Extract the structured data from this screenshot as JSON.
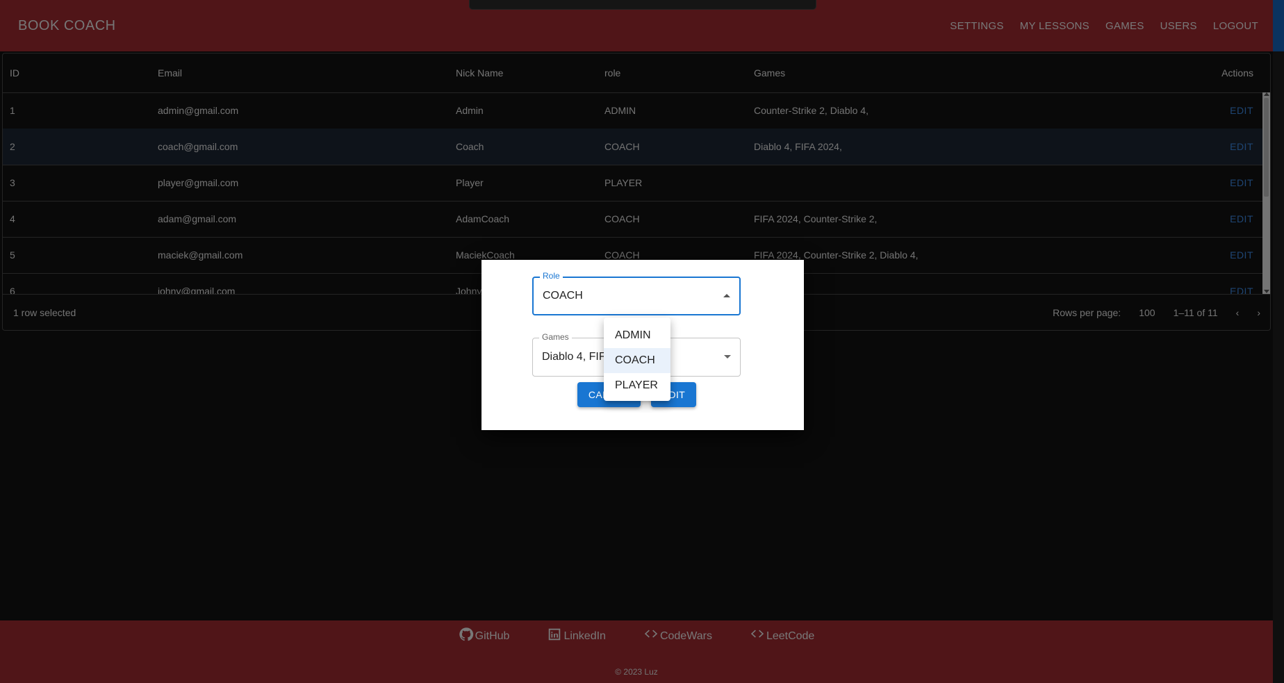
{
  "app": {
    "brand": "BOOK COACH",
    "nav": [
      "SETTINGS",
      "MY LESSONS",
      "GAMES",
      "USERS",
      "LOGOUT"
    ]
  },
  "table": {
    "columns": [
      "ID",
      "Email",
      "Nick Name",
      "role",
      "Games",
      "Actions"
    ],
    "rows": [
      {
        "id": "1",
        "email": "admin@gmail.com",
        "nick": "Admin",
        "role": "ADMIN",
        "games": "Counter-Strike 2, Diablo 4,",
        "action": "EDIT"
      },
      {
        "id": "2",
        "email": "coach@gmail.com",
        "nick": "Coach",
        "role": "COACH",
        "games": "Diablo 4, FIFA 2024,",
        "action": "EDIT"
      },
      {
        "id": "3",
        "email": "player@gmail.com",
        "nick": "Player",
        "role": "PLAYER",
        "games": "",
        "action": "EDIT"
      },
      {
        "id": "4",
        "email": "adam@gmail.com",
        "nick": "AdamCoach",
        "role": "COACH",
        "games": "FIFA 2024, Counter-Strike 2,",
        "action": "EDIT"
      },
      {
        "id": "5",
        "email": "maciek@gmail.com",
        "nick": "MaciekCoach",
        "role": "COACH",
        "games": "FIFA 2024, Counter-Strike 2, Diablo 4,",
        "action": "EDIT"
      },
      {
        "id": "6",
        "email": "johny@gmail.com",
        "nick": "Johny",
        "role": "",
        "games": "",
        "action": "EDIT"
      }
    ],
    "selected_text": "1 row selected",
    "rows_per_page_label": "Rows per page:",
    "rows_per_page": "100",
    "range": "1–11 of 11"
  },
  "dialog": {
    "role_label": "Role",
    "role_value": "COACH",
    "games_label": "Games",
    "games_value": "Diablo 4, FIFA 2024",
    "cancel": "CANCEL",
    "edit": "EDIT"
  },
  "role_menu": {
    "options": [
      "ADMIN",
      "COACH",
      "PLAYER"
    ],
    "selected": "COACH"
  },
  "footer": {
    "links": [
      {
        "label": "GitHub",
        "icon": "github-icon"
      },
      {
        "label": "LinkedIn",
        "icon": "linkedin-icon"
      },
      {
        "label": "CodeWars",
        "icon": "code-icon"
      },
      {
        "label": "LeetCode",
        "icon": "code-icon"
      }
    ],
    "copyright": "© 2023 Luz"
  },
  "colors": {
    "appbar": "#a12a31",
    "accent": "#1976d2",
    "background": "#121212"
  }
}
